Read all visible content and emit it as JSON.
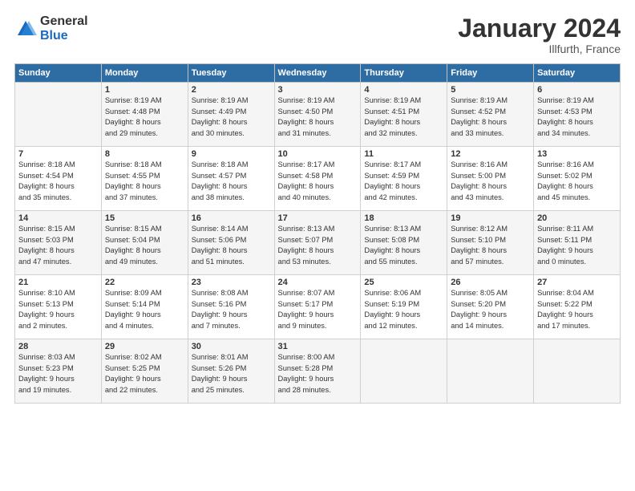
{
  "header": {
    "logo_general": "General",
    "logo_blue": "Blue",
    "month_title": "January 2024",
    "subtitle": "Illfurth, France"
  },
  "columns": [
    "Sunday",
    "Monday",
    "Tuesday",
    "Wednesday",
    "Thursday",
    "Friday",
    "Saturday"
  ],
  "weeks": [
    [
      {
        "day": "",
        "info": ""
      },
      {
        "day": "1",
        "info": "Sunrise: 8:19 AM\nSunset: 4:48 PM\nDaylight: 8 hours\nand 29 minutes."
      },
      {
        "day": "2",
        "info": "Sunrise: 8:19 AM\nSunset: 4:49 PM\nDaylight: 8 hours\nand 30 minutes."
      },
      {
        "day": "3",
        "info": "Sunrise: 8:19 AM\nSunset: 4:50 PM\nDaylight: 8 hours\nand 31 minutes."
      },
      {
        "day": "4",
        "info": "Sunrise: 8:19 AM\nSunset: 4:51 PM\nDaylight: 8 hours\nand 32 minutes."
      },
      {
        "day": "5",
        "info": "Sunrise: 8:19 AM\nSunset: 4:52 PM\nDaylight: 8 hours\nand 33 minutes."
      },
      {
        "day": "6",
        "info": "Sunrise: 8:19 AM\nSunset: 4:53 PM\nDaylight: 8 hours\nand 34 minutes."
      }
    ],
    [
      {
        "day": "7",
        "info": "Sunrise: 8:18 AM\nSunset: 4:54 PM\nDaylight: 8 hours\nand 35 minutes."
      },
      {
        "day": "8",
        "info": "Sunrise: 8:18 AM\nSunset: 4:55 PM\nDaylight: 8 hours\nand 37 minutes."
      },
      {
        "day": "9",
        "info": "Sunrise: 8:18 AM\nSunset: 4:57 PM\nDaylight: 8 hours\nand 38 minutes."
      },
      {
        "day": "10",
        "info": "Sunrise: 8:17 AM\nSunset: 4:58 PM\nDaylight: 8 hours\nand 40 minutes."
      },
      {
        "day": "11",
        "info": "Sunrise: 8:17 AM\nSunset: 4:59 PM\nDaylight: 8 hours\nand 42 minutes."
      },
      {
        "day": "12",
        "info": "Sunrise: 8:16 AM\nSunset: 5:00 PM\nDaylight: 8 hours\nand 43 minutes."
      },
      {
        "day": "13",
        "info": "Sunrise: 8:16 AM\nSunset: 5:02 PM\nDaylight: 8 hours\nand 45 minutes."
      }
    ],
    [
      {
        "day": "14",
        "info": "Sunrise: 8:15 AM\nSunset: 5:03 PM\nDaylight: 8 hours\nand 47 minutes."
      },
      {
        "day": "15",
        "info": "Sunrise: 8:15 AM\nSunset: 5:04 PM\nDaylight: 8 hours\nand 49 minutes."
      },
      {
        "day": "16",
        "info": "Sunrise: 8:14 AM\nSunset: 5:06 PM\nDaylight: 8 hours\nand 51 minutes."
      },
      {
        "day": "17",
        "info": "Sunrise: 8:13 AM\nSunset: 5:07 PM\nDaylight: 8 hours\nand 53 minutes."
      },
      {
        "day": "18",
        "info": "Sunrise: 8:13 AM\nSunset: 5:08 PM\nDaylight: 8 hours\nand 55 minutes."
      },
      {
        "day": "19",
        "info": "Sunrise: 8:12 AM\nSunset: 5:10 PM\nDaylight: 8 hours\nand 57 minutes."
      },
      {
        "day": "20",
        "info": "Sunrise: 8:11 AM\nSunset: 5:11 PM\nDaylight: 9 hours\nand 0 minutes."
      }
    ],
    [
      {
        "day": "21",
        "info": "Sunrise: 8:10 AM\nSunset: 5:13 PM\nDaylight: 9 hours\nand 2 minutes."
      },
      {
        "day": "22",
        "info": "Sunrise: 8:09 AM\nSunset: 5:14 PM\nDaylight: 9 hours\nand 4 minutes."
      },
      {
        "day": "23",
        "info": "Sunrise: 8:08 AM\nSunset: 5:16 PM\nDaylight: 9 hours\nand 7 minutes."
      },
      {
        "day": "24",
        "info": "Sunrise: 8:07 AM\nSunset: 5:17 PM\nDaylight: 9 hours\nand 9 minutes."
      },
      {
        "day": "25",
        "info": "Sunrise: 8:06 AM\nSunset: 5:19 PM\nDaylight: 9 hours\nand 12 minutes."
      },
      {
        "day": "26",
        "info": "Sunrise: 8:05 AM\nSunset: 5:20 PM\nDaylight: 9 hours\nand 14 minutes."
      },
      {
        "day": "27",
        "info": "Sunrise: 8:04 AM\nSunset: 5:22 PM\nDaylight: 9 hours\nand 17 minutes."
      }
    ],
    [
      {
        "day": "28",
        "info": "Sunrise: 8:03 AM\nSunset: 5:23 PM\nDaylight: 9 hours\nand 19 minutes."
      },
      {
        "day": "29",
        "info": "Sunrise: 8:02 AM\nSunset: 5:25 PM\nDaylight: 9 hours\nand 22 minutes."
      },
      {
        "day": "30",
        "info": "Sunrise: 8:01 AM\nSunset: 5:26 PM\nDaylight: 9 hours\nand 25 minutes."
      },
      {
        "day": "31",
        "info": "Sunrise: 8:00 AM\nSunset: 5:28 PM\nDaylight: 9 hours\nand 28 minutes."
      },
      {
        "day": "",
        "info": ""
      },
      {
        "day": "",
        "info": ""
      },
      {
        "day": "",
        "info": ""
      }
    ]
  ]
}
